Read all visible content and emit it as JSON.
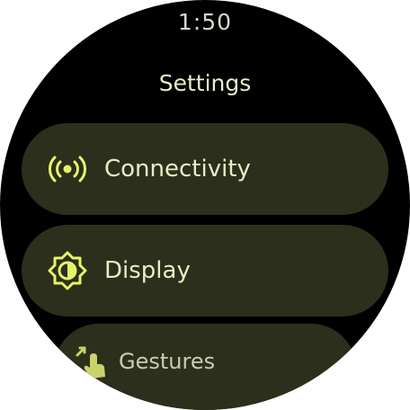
{
  "status": {
    "time": "1:50"
  },
  "header": {
    "title": "Settings"
  },
  "settings_list": {
    "items": [
      {
        "label": "Connectivity",
        "icon": "connectivity-icon"
      },
      {
        "label": "Display",
        "icon": "display-brightness-icon"
      },
      {
        "label": "Gestures",
        "icon": "gestures-icon"
      }
    ]
  },
  "colors": {
    "background": "#000000",
    "chip": "#2c2f1b",
    "accent": "#e3f36b",
    "text": "#e8ecc6"
  }
}
